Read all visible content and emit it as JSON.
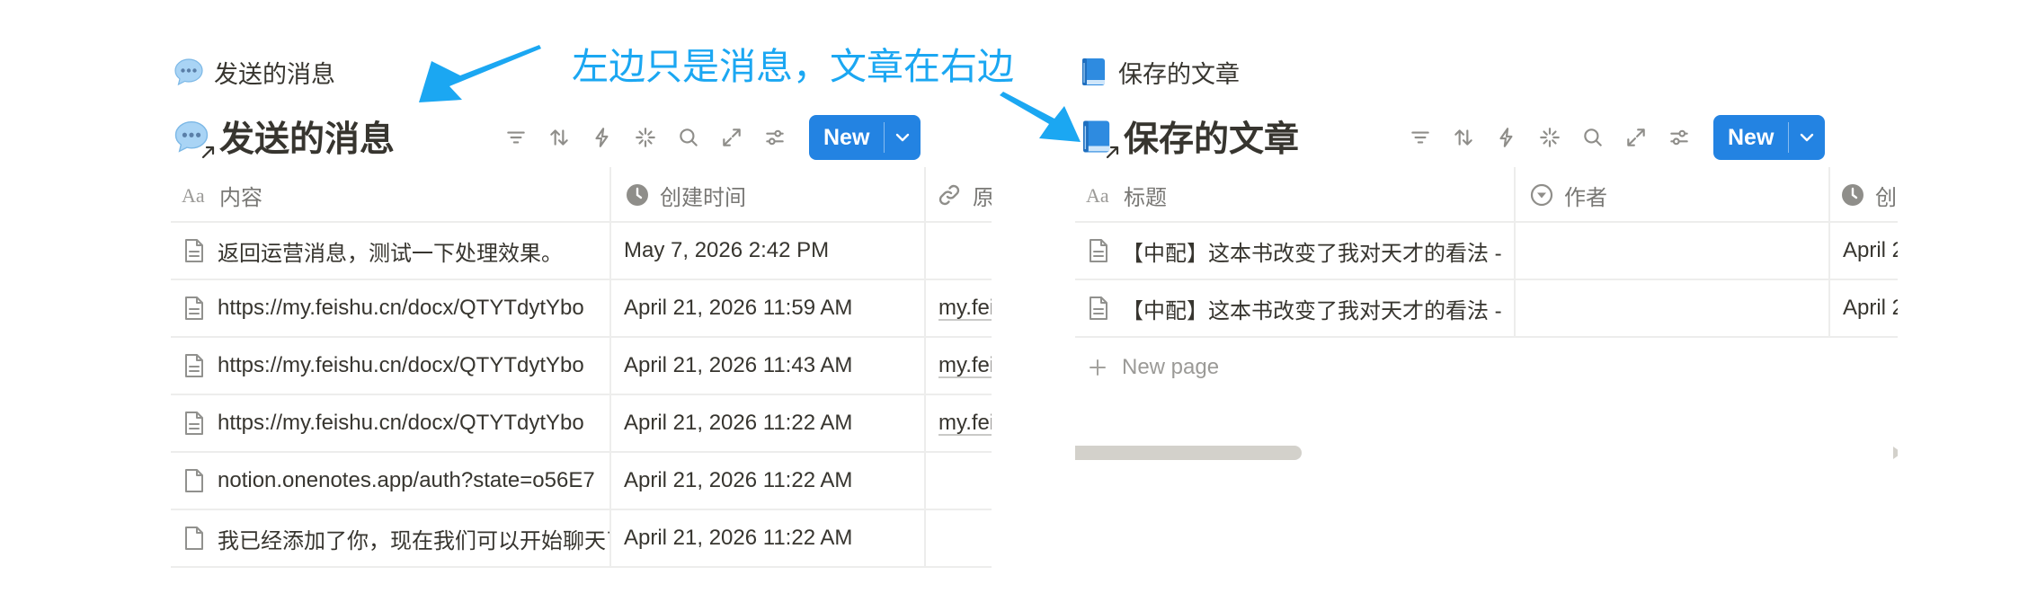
{
  "annotation": {
    "text": "左边只是消息，文章在右边",
    "color": "#1ba7f2"
  },
  "colors": {
    "accent": "#2383e2",
    "text": "#37352f",
    "muted": "#787774",
    "placeholder": "#9b9a97",
    "border": "#ededec"
  },
  "left": {
    "view_tab": {
      "icon": "speech-bubble-icon",
      "label": "发送的消息"
    },
    "title": {
      "icon": "speech-bubble-icon",
      "text": "发送的消息"
    },
    "toolbar": {
      "icons": [
        "filter-icon",
        "sort-icon",
        "lightning-icon",
        "sparkle-icon",
        "search-icon",
        "expand-icon",
        "settings-sliders-icon"
      ],
      "new_label": "New"
    },
    "columns": [
      {
        "icon": "text-type-icon",
        "label": "内容"
      },
      {
        "icon": "clock-icon",
        "label": "创建时间"
      },
      {
        "icon": "link-icon",
        "label": "原"
      }
    ],
    "rows": [
      {
        "content": "返回运营消息，测试一下处理效果。",
        "created": "May 7, 2026 2:42 PM",
        "link": ""
      },
      {
        "content": "https://my.feishu.cn/docx/QTYTdytYbo",
        "created": "April 21, 2026 11:59 AM",
        "link": "my.fei"
      },
      {
        "content": "https://my.feishu.cn/docx/QTYTdytYbo",
        "created": "April 21, 2026 11:43 AM",
        "link": "my.fei"
      },
      {
        "content": "https://my.feishu.cn/docx/QTYTdytYbo",
        "created": "April 21, 2026 11:22 AM",
        "link": "my.fei"
      },
      {
        "content": "notion.onenotes.app/auth?state=o56E7",
        "created": "April 21, 2026 11:22 AM",
        "link": ""
      },
      {
        "content": "我已经添加了你，现在我们可以开始聊天了",
        "created": "April 21, 2026 11:22 AM",
        "link": ""
      }
    ]
  },
  "right": {
    "view_tab": {
      "icon": "blue-book-icon",
      "label": "保存的文章"
    },
    "title": {
      "icon": "blue-book-icon",
      "text": "保存的文章"
    },
    "toolbar": {
      "icons": [
        "filter-icon",
        "sort-icon",
        "lightning-icon",
        "sparkle-icon",
        "search-icon",
        "expand-icon",
        "settings-sliders-icon"
      ],
      "new_label": "New"
    },
    "columns": [
      {
        "icon": "text-type-icon",
        "label": "标题"
      },
      {
        "icon": "select-icon",
        "label": "作者"
      },
      {
        "icon": "clock-icon",
        "label": "创"
      }
    ],
    "rows": [
      {
        "title": "【中配】这本书改变了我对天才的看法 -",
        "author": "",
        "created": "April 2"
      },
      {
        "title": "【中配】这本书改变了我对天才的看法 -",
        "author": "",
        "created": "April 2"
      }
    ],
    "new_page_label": "New page"
  }
}
